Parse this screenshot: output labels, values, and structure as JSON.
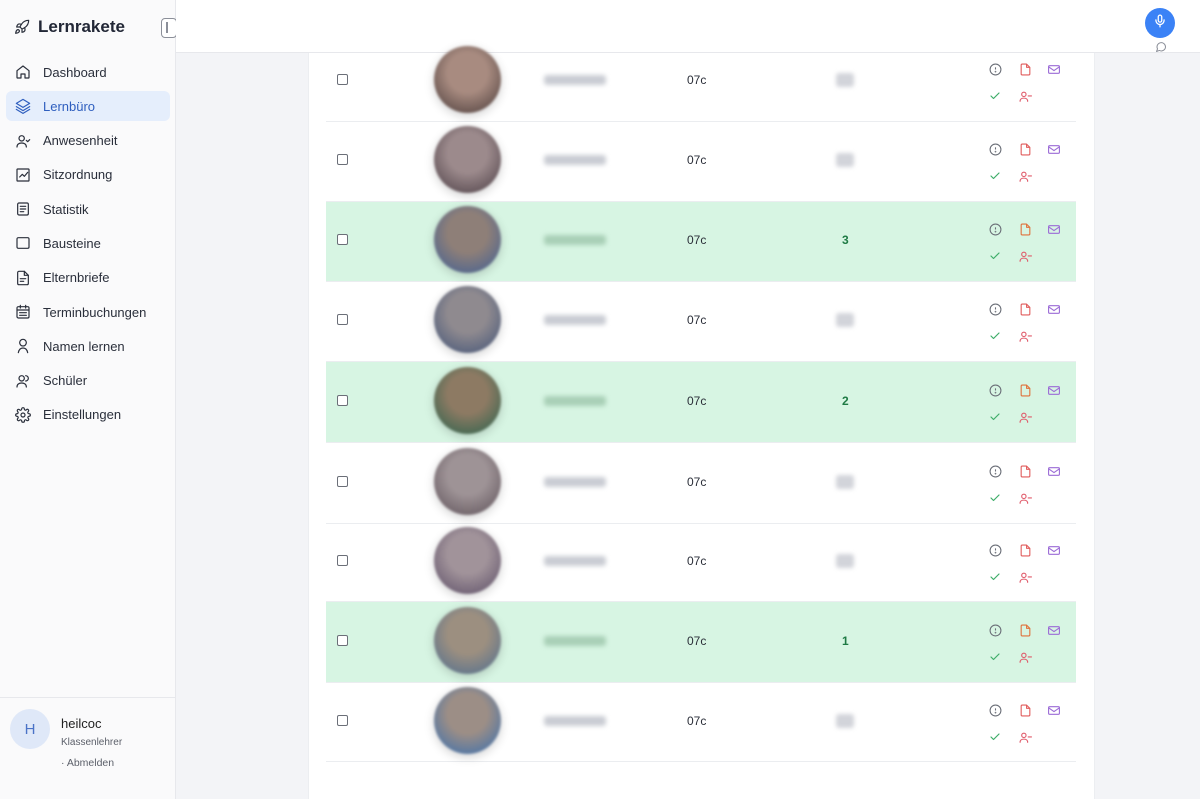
{
  "app": {
    "title": "Lernrakete"
  },
  "sidebar": {
    "items": [
      {
        "label": "Dashboard",
        "icon": "home-icon",
        "active": false
      },
      {
        "label": "Lernbüro",
        "icon": "layers-icon",
        "active": true
      },
      {
        "label": "Anwesenheit",
        "icon": "user-icon",
        "active": false
      },
      {
        "label": "Sitzordnung",
        "icon": "chart-icon",
        "active": false
      },
      {
        "label": "Statistik",
        "icon": "list-icon",
        "active": false
      },
      {
        "label": "Bausteine",
        "icon": "square-icon",
        "active": false
      },
      {
        "label": "Elternbriefe",
        "icon": "file-icon",
        "active": false
      },
      {
        "label": "Terminbuchungen",
        "icon": "calendar-icon",
        "active": false
      },
      {
        "label": "Namen lernen",
        "icon": "person-icon",
        "active": false
      },
      {
        "label": "Schüler",
        "icon": "users-icon",
        "active": false
      },
      {
        "label": "Einstellungen",
        "icon": "gear-icon",
        "active": false
      }
    ]
  },
  "user": {
    "initial": "H",
    "name": "heilcoc",
    "role": "Klassenlehrer",
    "logout": "· Abmelden"
  },
  "colors": {
    "accent": "#3b82f6",
    "active_bg": "#e5eefc",
    "highlight_row": "#d7f5e3",
    "count_green": "#1e7a44"
  },
  "students": [
    {
      "class": "07c",
      "count": "",
      "highlight": false
    },
    {
      "class": "07c",
      "count": "",
      "highlight": false
    },
    {
      "class": "07c",
      "count": "3",
      "highlight": true
    },
    {
      "class": "07c",
      "count": "",
      "highlight": false
    },
    {
      "class": "07c",
      "count": "2",
      "highlight": true
    },
    {
      "class": "07c",
      "count": "",
      "highlight": false
    },
    {
      "class": "07c",
      "count": "",
      "highlight": false
    },
    {
      "class": "07c",
      "count": "1",
      "highlight": true
    },
    {
      "class": "07c",
      "count": "",
      "highlight": false
    }
  ]
}
